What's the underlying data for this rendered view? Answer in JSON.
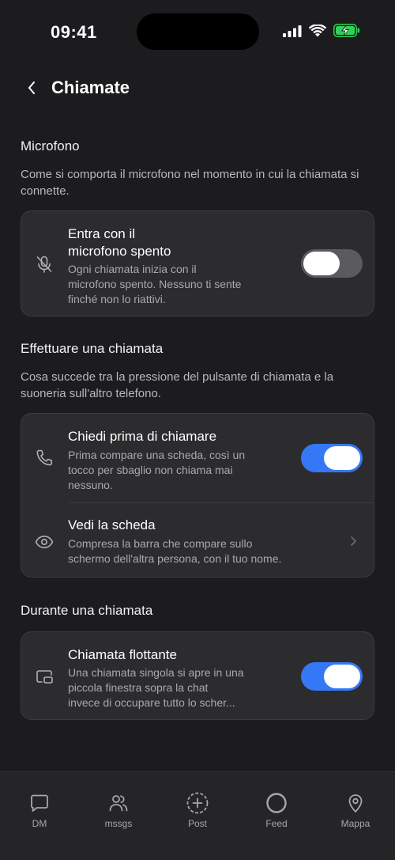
{
  "status_bar": {
    "time": "09:41"
  },
  "header": {
    "title": "Chiamate"
  },
  "sections": [
    {
      "title": "Microfono",
      "description": "Come si comporta il microfono nel momento in cui la chiamata si connette.",
      "rows": [
        {
          "icon": "mic-off-icon",
          "title_line1": "Entra con il",
          "title_line2": "microfono spento",
          "desc_line1": "Ogni chiamata inizia con il",
          "desc_line2": "microfono spento. Nessuno ti sente",
          "desc_line3": "finché non lo riattivi.",
          "toggle": "off"
        }
      ]
    },
    {
      "title": "Effettuare una chiamata",
      "description_line1": "Cosa succede tra la pressione del pulsante di chiamata e la",
      "description_line2": "suoneria sull'altro telefono.",
      "rows": [
        {
          "icon": "phone-icon",
          "title": "Chiedi prima di chiamare",
          "desc_line1": "Prima compare una scheda, così un",
          "desc_line2": "tocco per sbaglio non chiama mai",
          "desc_line3": "nessuno.",
          "toggle": "on"
        },
        {
          "icon": "eye-icon",
          "title": "Vedi la scheda",
          "desc_line1": "Compresa la barra che compare sullo",
          "desc_line2": "schermo dell'altra persona, con il tuo nome."
        }
      ]
    },
    {
      "title": "Durante una chiamata",
      "rows": [
        {
          "icon": "picture-in-picture-icon",
          "title": "Chiamata flottante",
          "desc_line1": "Una chiamata singola si apre in una",
          "desc_line2": "piccola finestra sopra la chat",
          "desc_line3": "invece di occupare tutto lo scher...",
          "toggle": "on"
        }
      ]
    }
  ],
  "tab_bar": [
    {
      "label": "DM",
      "icon": "chat-bubble-icon"
    },
    {
      "label": "mssgs",
      "icon": "people-icon"
    },
    {
      "label": "Post",
      "icon": "plus-circle-icon"
    },
    {
      "label": "Feed",
      "icon": "ring-icon"
    },
    {
      "label": "Mappa",
      "icon": "map-pin-icon"
    }
  ],
  "colors": {
    "background": "#1c1c1e",
    "card": "#2c2c2f",
    "toggle_on": "#3478f6",
    "toggle_off": "#5b5b5f",
    "battery": "#30d158"
  }
}
